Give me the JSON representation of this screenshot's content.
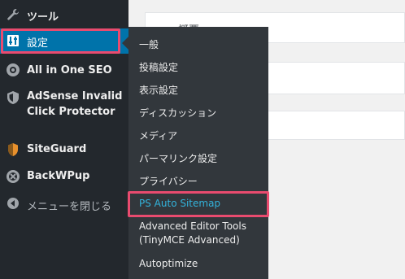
{
  "sidebar": {
    "items": [
      {
        "label": "ツール",
        "icon": "wrench-icon"
      },
      {
        "label": "設定",
        "icon": "settings-sliders-icon"
      },
      {
        "label": "All in One SEO",
        "icon": "aioseo-gear-icon"
      },
      {
        "label_line1": "AdSense Invalid",
        "label_line2": "Click Protector",
        "icon": "shield-icon"
      },
      {
        "label": "SiteGuard",
        "icon": "siteguard-icon"
      },
      {
        "label": "BackWPup",
        "icon": "backwpup-icon"
      },
      {
        "label": "メニューを閉じる",
        "icon": "collapse-menu-icon"
      }
    ]
  },
  "submenu": {
    "items": [
      {
        "label": "一般"
      },
      {
        "label": "投稿設定"
      },
      {
        "label": "表示設定"
      },
      {
        "label": "ディスカッション"
      },
      {
        "label": "メディア"
      },
      {
        "label": "パーマリンク設定"
      },
      {
        "label": "プライバシー"
      },
      {
        "label": "PS Auto Sitemap"
      },
      {
        "label_line1": "Advanced Editor Tools",
        "label_line2": "(TinyMCE Advanced)"
      },
      {
        "label": "Autoptimize"
      }
    ]
  },
  "content": {
    "card_title": "概要"
  },
  "colors": {
    "sidebar_bg": "#23282d",
    "flyout_bg": "#32373c",
    "active_bg": "#0073aa",
    "current_link": "#33b3db",
    "highlight": "#e94b6f"
  }
}
